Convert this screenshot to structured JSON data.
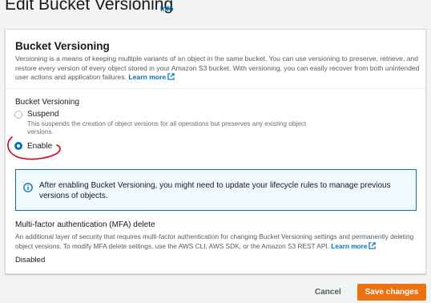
{
  "header": {
    "title": "Edit Bucket Versioning",
    "info_link": "Info"
  },
  "panel": {
    "title": "Bucket Versioning",
    "description": "Versioning is a means of keeping multiple variants of an object in the same bucket. You can use versioning to preserve, retrieve, and restore every version of every object stored in your Amazon S3 bucket. With versioning, you can easily recover from both unintended user actions and application failures.",
    "learn_more": "Learn more",
    "field_label": "Bucket Versioning",
    "options": [
      {
        "label": "Suspend",
        "description": "This suspends the creation of object versions for all operations but preserves any existing object versions.",
        "selected": false
      },
      {
        "label": "Enable",
        "description": "",
        "selected": true
      }
    ],
    "alert": {
      "icon": "info-icon",
      "text": "After enabling Bucket Versioning, you might need to update your lifecycle rules to manage previous versions of objects."
    },
    "mfa": {
      "title": "Multi-factor authentication (MFA) delete",
      "description": "An additional layer of security that requires multi-factor authentication for changing Bucket Versioning settings and permanently deleting object versions. To modify MFA delete settings, use the AWS CLI, AWS SDK, or the Amazon S3 REST API.",
      "learn_more": "Learn more",
      "value": "Disabled"
    }
  },
  "footer": {
    "cancel_label": "Cancel",
    "save_label": "Save changes"
  },
  "colors": {
    "accent": "#0073bb",
    "primary_button": "#ec7211",
    "annotation": "#d0021b"
  }
}
